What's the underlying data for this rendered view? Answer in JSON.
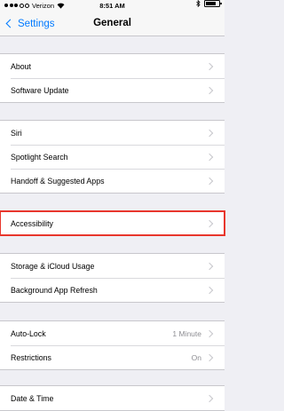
{
  "status_bar": {
    "carrier": "Verizon",
    "time": "8:51 AM"
  },
  "nav": {
    "back_label": "Settings",
    "title": "General"
  },
  "groups": [
    {
      "rows": [
        {
          "label": "About"
        },
        {
          "label": "Software Update"
        }
      ]
    },
    {
      "rows": [
        {
          "label": "Siri"
        },
        {
          "label": "Spotlight Search"
        },
        {
          "label": "Handoff & Suggested Apps"
        }
      ]
    },
    {
      "rows": [
        {
          "label": "Accessibility",
          "highlighted": true
        }
      ]
    },
    {
      "rows": [
        {
          "label": "Storage & iCloud Usage"
        },
        {
          "label": "Background App Refresh"
        }
      ]
    },
    {
      "rows": [
        {
          "label": "Auto-Lock",
          "value": "1 Minute"
        },
        {
          "label": "Restrictions",
          "value": "On"
        }
      ]
    },
    {
      "rows": [
        {
          "label": "Date & Time"
        }
      ]
    }
  ],
  "colors": {
    "accent": "#007aff",
    "highlight": "#e8362c",
    "background": "#efeff4"
  }
}
